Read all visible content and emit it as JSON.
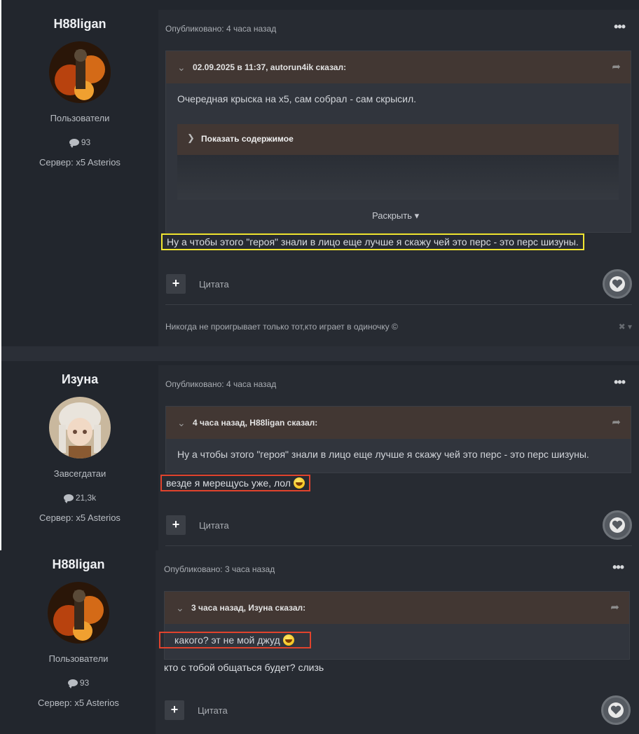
{
  "posts": [
    {
      "author": {
        "name": "H88ligan",
        "group": "Пользователи",
        "posts_count": "93",
        "server": "Сервер: x5 Asterios"
      },
      "meta": "Опубликовано: 4 часа назад",
      "menu": "•••",
      "quote": {
        "header": "02.09.2025 в 11:37, autorun4ik сказал:",
        "text": "Очередная крыска на x5, сам собрал - сам скрысил.",
        "spoiler_label": "Показать содержимое",
        "expand_label": "Раскрыть ▾"
      },
      "text": "Ну а чтобы этого \"героя\" знали в лицо еще лучше я скажу чей это перс - это перс шизуны.",
      "quote_button": "Цитата",
      "signature": "Никогда не проигрывает только тот,кто играет в одиночку ©",
      "signature_close": "✖ ▾"
    },
    {
      "author": {
        "name": "Изуна",
        "group": "Завсегдатаи",
        "posts_count": "21,3k",
        "server": "Сервер: x5 Asterios"
      },
      "meta": "Опубликовано: 4 часа назад",
      "menu": "•••",
      "quote": {
        "header": "4 часа назад, H88ligan сказал:",
        "text": "Ну а чтобы этого \"героя\" знали в лицо еще лучше я скажу чей это перс - это перс шизуны."
      },
      "text": "везде я мерещусь уже, лол",
      "quote_button": "Цитата"
    },
    {
      "author": {
        "name": "H88ligan",
        "group": "Пользователи",
        "posts_count": "93",
        "server": "Сервер: x5 Asterios"
      },
      "meta": "Опубликовано: 3 часа назад",
      "menu": "•••",
      "quote": {
        "header": "3 часа назад, Изуна сказал:",
        "text": "какого? эт не мой джуд"
      },
      "text": "кто с тобой общаться будет? слизь",
      "quote_button": "Цитата"
    }
  ],
  "colors": {
    "background": "#22262d",
    "quote_header": "#423733",
    "highlight_yellow": "#f1e631",
    "highlight_red": "#e0432d"
  },
  "icons": [
    "chevron-down-icon",
    "share-icon",
    "chevron-right-icon",
    "plus-icon",
    "heart-icon",
    "comment-icon",
    "smiley-icon",
    "ellipsis-icon",
    "close-icon"
  ]
}
